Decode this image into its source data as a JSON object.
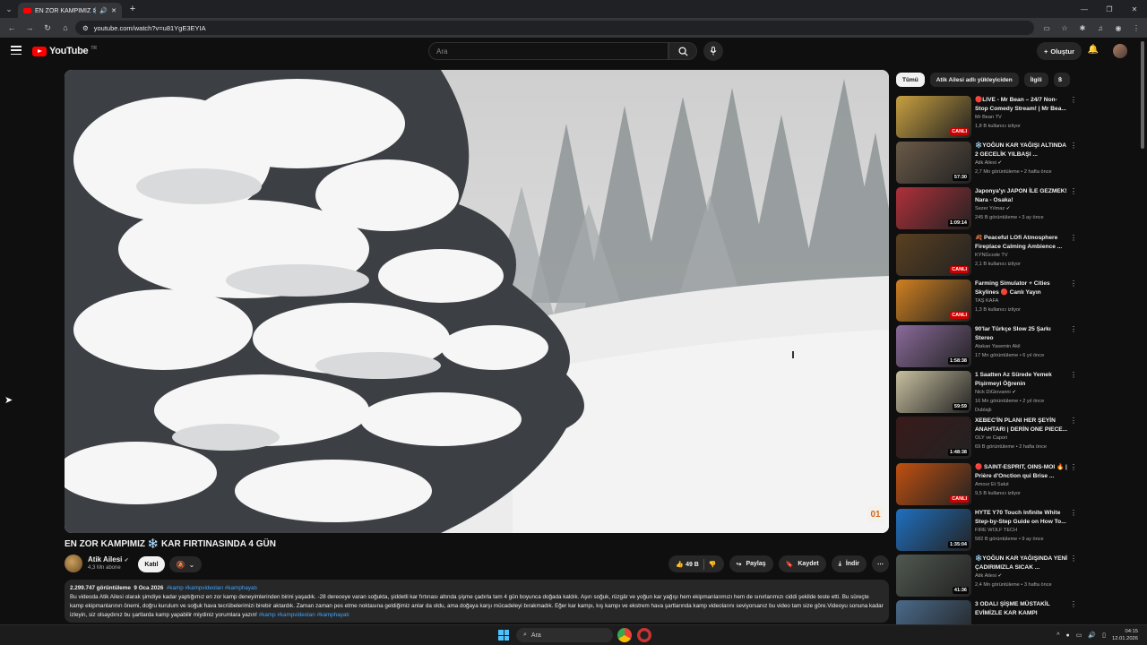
{
  "browser": {
    "tab_title": "EN ZOR KAMPIMIZ ❄️ KAR",
    "url": "youtube.com/watch?v=u81YgE3EYIA"
  },
  "header": {
    "logo_text": "YouTube",
    "logo_country": "TR",
    "search_placeholder": "Ara",
    "create_label": "Oluştur"
  },
  "video": {
    "title": "EN ZOR KAMPIMIZ ❄️ KAR FIRTINASINDA 4 GÜN",
    "watermark": "01",
    "channel": "Atik Ailesi",
    "subscribers": "4,3 Mn abone",
    "join_label": "Katıl",
    "likes": "49 B",
    "share_label": "Paylaş",
    "save_label": "Kaydet",
    "download_label": "İndir"
  },
  "description": {
    "views": "2.299.747 görüntüleme",
    "date": "9 Oca 2026",
    "tags": "#kamp #kampvideoları #kamphayatı",
    "body": "Bu videoda Atik Ailesi olarak şimdiye kadar yaptığımız en zor kamp deneyimlerinden birini yaşadık. -28 dereceye varan soğukta, şiddetli kar fırtınası altında şişme çadırla tam 4 gün boyunca doğada kaldık. Aşırı soğuk, rüzgâr ve yoğun kar yağışı hem ekipmanlarımızı hem de sınırlarımızı ciddi şekilde teste etti. Bu süreçte kamp ekipmanlarının önemi, doğru kurulum ve soğuk hava tecrübelerimizi birebir aktardık. Zaman zaman pes etme noktasına geldiğimiz anlar da oldu, ama doğaya karşı mücadeleyi bırakmadık. Eğer kar kampı, kış kampı ve ekstrem hava şartlarında kamp videolarını seviyorsanız bu video tam size göre.Videoyu sonuna kadar izleyin, siz olsaydınız bu şartlarda kamp yapabilir miydiniz yorumlara yazın!",
    "body_tags": "#kamp #kampvideoları #kamphayatı"
  },
  "chips": [
    "Tümü",
    "Atik Ailesi adlı yükleyiciden",
    "İlgili",
    "S"
  ],
  "recommendations": [
    {
      "title": "🔴LIVE - Mr Bean – 24/7 Non-Stop Comedy Stream! | Mr Bea...",
      "channel": "Mr Bean TV",
      "stats": "1,8 B kullanıcı izliyor",
      "badge": "CANLI",
      "live": true,
      "color": "#c8a040"
    },
    {
      "title": "❄️YOĞUN KAR YAĞIŞI ALTINDA 2 GECELİK YILBAŞI ...",
      "channel": "Atik Ailesi ✔",
      "stats": "2,7 Mn görüntüleme • 2 hafta önce",
      "badge": "57:30",
      "live": false,
      "color": "#6b5a48"
    },
    {
      "title": "Japonya'yı JAPON İLE GEZMEK! Nara - Osaka!",
      "channel": "Sezer Yılmaz ✔",
      "stats": "245 B görüntüleme • 3 ay önce",
      "badge": "1:09:14",
      "live": false,
      "color": "#b0303a"
    },
    {
      "title": "🍂 Peaceful LOfi Atmosphere Fireplace Calming Ambience ...",
      "channel": "KYNGcode TV",
      "stats": "2,1 B kullanıcı izliyor",
      "badge": "CANLI",
      "live": true,
      "color": "#5a4020"
    },
    {
      "title": "Farming Simulator + Cities Skylines 🔴 Canlı Yayın",
      "channel": "TAŞ KAFA",
      "stats": "1,3 B kullanıcı izliyor",
      "badge": "CANLI",
      "live": true,
      "color": "#d08020"
    },
    {
      "title": "90'lar Türkçe Slow 25 Şarkı Stereo",
      "channel": "Atakan Yasemin Akil",
      "stats": "17 Mn görüntüleme • 6 yıl önce",
      "badge": "1:58:38",
      "live": false,
      "color": "#8a6a9a"
    },
    {
      "title": "1 Saatten Az Sürede Yemek Pişirmeyi Öğrenin",
      "channel": "Nick DiGiovanni ✔",
      "stats": "16 Mn görüntüleme • 2 yıl önce",
      "badge": "59:59",
      "live": false,
      "color": "#c8c0a0",
      "extra": "Dublajlı"
    },
    {
      "title": "XEBEC'İN PLANI HER ŞEYİN ANAHTARI | DERİN ONE PIECE...",
      "channel": "OLY ve Capori",
      "stats": "69 B görüntüleme • 2 hafta önce",
      "badge": "1:48:38",
      "live": false,
      "color": "#3a1a1a"
    },
    {
      "title": "🔴 SAINT-ESPRIT, OINS-MOI 🔥 | Prière d'Onction qui Brise ...",
      "channel": "Amour Et Salut",
      "stats": "9,5 B kullanıcı izliyor",
      "badge": "CANLI",
      "live": true,
      "color": "#c05010"
    },
    {
      "title": "HYTE Y70 Touch Infinite White Step-by-Step Guide on How To...",
      "channel": "FIRE WOLF TECH",
      "stats": "582 B görüntüleme • 9 ay önce",
      "badge": "1:35:04",
      "live": false,
      "color": "#2070c0"
    },
    {
      "title": "❄️YOĞUN KAR YAĞIŞINDA YENİ ÇADIRIMIZLA SICAK ...",
      "channel": "Atik Ailesi ✔",
      "stats": "2,4 Mn görüntüleme • 3 hafta önce",
      "badge": "41:36",
      "live": false,
      "color": "#505850"
    },
    {
      "title": "3 ODALI ŞİŞME MÜSTAKİL EVİMİZLE KAR KAMPI",
      "channel": "",
      "stats": "",
      "badge": "",
      "live": false,
      "color": "#4a6a8a"
    }
  ],
  "taskbar": {
    "search": "Ara",
    "time": "04:15",
    "date": "12.01.2026"
  }
}
